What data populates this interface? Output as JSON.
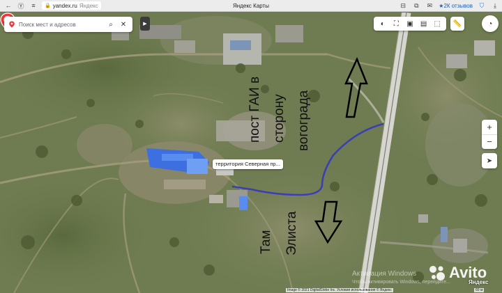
{
  "browser": {
    "host": "yandex.ru",
    "path": "Яндекс",
    "title": "Яндекс Карты",
    "reviews": "★2К отзывов",
    "icons": [
      "yandex-y-icon",
      "reader-icon",
      "lock-icon",
      "ext-icon",
      "bookmark-icon",
      "shield-icon",
      "more-icon"
    ]
  },
  "search": {
    "placeholder": "Поиск мест и адресов",
    "value": ""
  },
  "layers": [
    "map-layer-icon",
    "panorama-icon",
    "traffic-icon",
    "bus-icon",
    "route-icon"
  ],
  "placemark": {
    "label": "территория Северная пр..."
  },
  "annotations": {
    "gai": "пост ГАИ в",
    "direction": "сторону",
    "city": "вогограда",
    "there": "Там",
    "elista": "Элиста"
  },
  "watermark": {
    "line1": "Активация Windows",
    "line2": "Чтобы активировать Windows, перейдите..."
  },
  "footer": {
    "copyright": "Image © 2021 DigitalGlobe Inc.  Условия использования  © Яндекс",
    "brand": "Яндекс",
    "scale": "60 м",
    "avito": "Avito"
  },
  "colors": {
    "route": "#3a3fb3",
    "placemark": "#f2353b",
    "warehouse": "#3d6fe0"
  }
}
